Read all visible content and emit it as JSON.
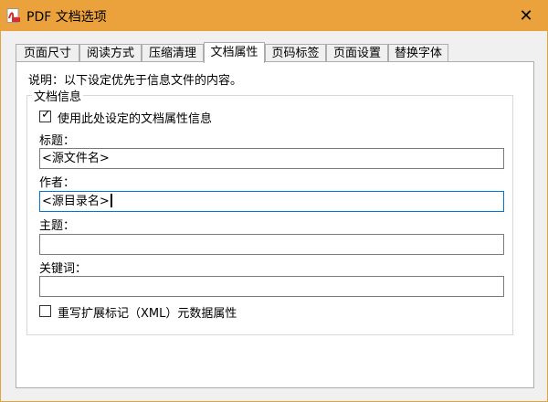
{
  "window": {
    "title": "PDF 文档选项",
    "close_symbol": "✕",
    "accent_color": "#eba23c",
    "app_icon": "pdf-icon"
  },
  "tabs": [
    {
      "label": "页面尺寸",
      "active": false
    },
    {
      "label": "阅读方式",
      "active": false
    },
    {
      "label": "压缩清理",
      "active": false
    },
    {
      "label": "文档属性",
      "active": true
    },
    {
      "label": "页码标签",
      "active": false
    },
    {
      "label": "页面设置",
      "active": false
    },
    {
      "label": "替换字体",
      "active": false
    }
  ],
  "main": {
    "note": "说明：以下设定优先于信息文件的内容。",
    "group_title": "文档信息",
    "use_properties": {
      "label": "使用此处设定的文档属性信息",
      "checked": true
    },
    "title_label": "标题：",
    "title_value": "<源文件名>",
    "author_label": "作者：",
    "author_value": "<源目录名>",
    "subject_label": "主题：",
    "subject_value": "",
    "keywords_label": "关键词：",
    "keywords_value": "",
    "overwrite_xmp": {
      "label": "重写扩展标记（XML）元数据属性",
      "checked": false
    }
  }
}
